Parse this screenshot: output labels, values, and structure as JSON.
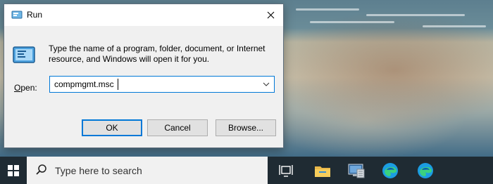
{
  "dialog": {
    "title": "Run",
    "description": "Type the name of a program, folder, document, or Internet resource, and Windows will open it for you.",
    "open_label_mnemonic": "O",
    "open_label_rest": "pen:",
    "open_value": "compmgmt.msc",
    "buttons": {
      "ok": "OK",
      "cancel": "Cancel",
      "browse": "Browse..."
    }
  },
  "taskbar": {
    "search_placeholder": "Type here to search",
    "icons": [
      "windows-start-icon",
      "search-icon",
      "task-view-icon",
      "file-explorer-icon",
      "computer-management-icon",
      "edge-icon",
      "edge-icon"
    ]
  },
  "colors": {
    "accent": "#0078d7",
    "taskbar": "#1f2b33"
  }
}
